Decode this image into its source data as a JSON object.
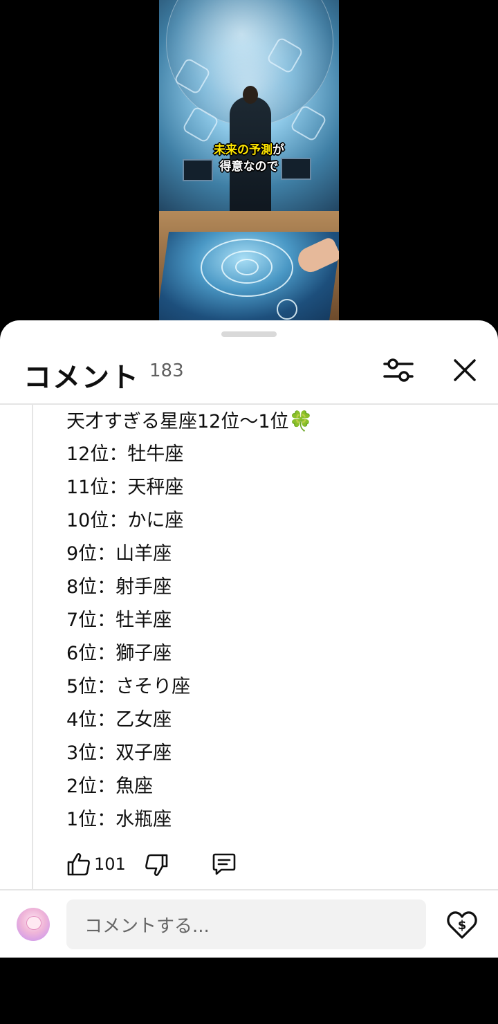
{
  "video": {
    "caption_line1_highlight": "未来の予測",
    "caption_line1_rest": "が",
    "caption_line2": "得意なので"
  },
  "comments_panel": {
    "title": "コメント",
    "count": "183",
    "filter_icon": "sliders-icon",
    "close_icon": "close-icon"
  },
  "comment": {
    "lines": [
      "天才すぎる星座12位〜1位",
      "12位：牡牛座",
      "11位：天秤座",
      "10位：かに座",
      "9位：山羊座",
      "8位：射手座",
      "7位：牡羊座",
      "6位：獅子座",
      "5位：さそり座",
      "4位：乙女座",
      "3位：双子座",
      "2位：魚座",
      "1位：水瓶座"
    ],
    "emoji": "🍀",
    "likes": "101",
    "colors": {
      "clover": "#1db33b"
    }
  },
  "composer": {
    "placeholder": "コメントする..."
  }
}
